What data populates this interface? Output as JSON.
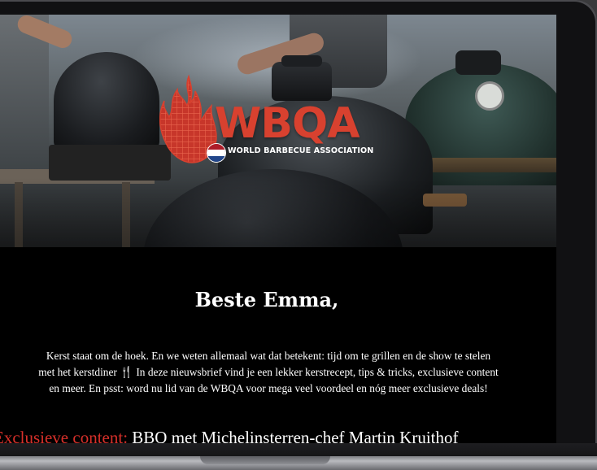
{
  "logo": {
    "wordmark": "WBQA",
    "tagline": "WORLD BARBECUE ASSOCIATION",
    "brand_color": "#d8412f"
  },
  "email": {
    "greeting": "Beste Emma,",
    "intro_lines": [
      "Kerst staat om de hoek. En we weten allemaal wat dat betekent: tijd om te grillen en de show te stelen",
      "met het kerstdiner",
      "In deze nieuwsbrief vind je een lekker kerstrecept, tips & tricks, exclusieve content",
      "en meer. En psst: word nu lid van de WBQA voor mega veel voordeel en nóg meer exclusieve deals!"
    ],
    "utensil_glyph": "🍴",
    "feature_label": "Exclusieve content:",
    "feature_title": "BBQ met Michelinsterren-chef Martin Kruithof",
    "accent_color": "#d7302a"
  },
  "icons": {
    "logo_flame": "flame-grid-icon",
    "flag": "netherlands-flag-icon",
    "utensil": "fork-knife-icon"
  }
}
